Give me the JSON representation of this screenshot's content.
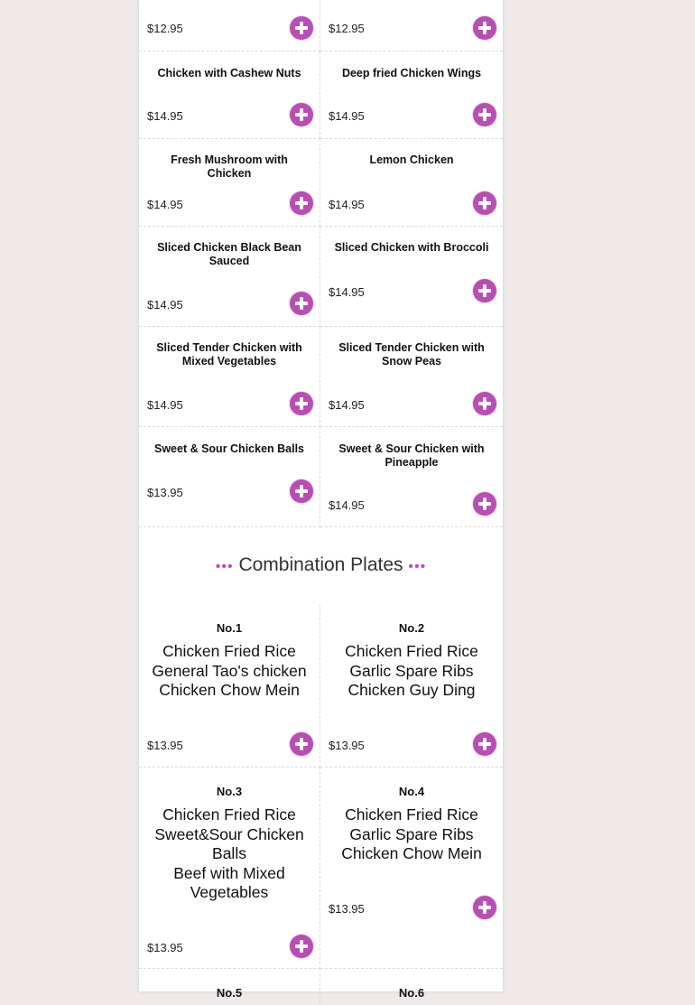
{
  "menu_items": [
    {
      "name": "",
      "price": "$12.95"
    },
    {
      "name": "",
      "price": "$12.95"
    },
    {
      "name": "Chicken with Cashew Nuts",
      "price": "$14.95"
    },
    {
      "name": "Deep fried Chicken Wings",
      "price": "$14.95"
    },
    {
      "name": "Fresh Mushroom with Chicken",
      "price": "$14.95"
    },
    {
      "name": "Lemon Chicken",
      "price": "$14.95"
    },
    {
      "name": "Sliced Chicken Black Bean Sauced",
      "price": "$14.95"
    },
    {
      "name": "Sliced Chicken with Broccoli",
      "price": "$14.95"
    },
    {
      "name": "Sliced Tender Chicken with Mixed Vegetables",
      "price": "$14.95"
    },
    {
      "name": "Sliced Tender Chicken with Snow Peas",
      "price": "$14.95"
    },
    {
      "name": "Sweet & Sour Chicken Balls",
      "price": "$13.95"
    },
    {
      "name": "Sweet & Sour Chicken with Pineapple",
      "price": "$14.95"
    }
  ],
  "combination_section": {
    "title": "Combination Plates",
    "decoration": "•••"
  },
  "combos": [
    {
      "number": "No.1",
      "lines": [
        "Chicken Fried Rice",
        "General Tao's chicken",
        "Chicken Chow Mein"
      ],
      "price": "$13.95"
    },
    {
      "number": "No.2",
      "lines": [
        "Chicken Fried Rice",
        "Garlic Spare Ribs",
        "Chicken Guy Ding"
      ],
      "price": "$13.95"
    },
    {
      "number": "No.3",
      "lines": [
        "Chicken Fried Rice",
        "Sweet&Sour Chicken Balls",
        "Beef with Mixed Vegetables"
      ],
      "price": "$13.95"
    },
    {
      "number": "No.4",
      "lines": [
        "Chicken Fried Rice",
        "Garlic Spare Ribs",
        "Chicken Chow Mein"
      ],
      "price": "$13.95"
    },
    {
      "number": "No.5",
      "lines": [],
      "price": ""
    },
    {
      "number": "No.6",
      "lines": [],
      "price": ""
    }
  ],
  "colors": {
    "accent": "#b84db4",
    "background": "#efe9e9",
    "panel": "#ffffff"
  },
  "icons": {
    "add": "plus-circle-icon"
  }
}
